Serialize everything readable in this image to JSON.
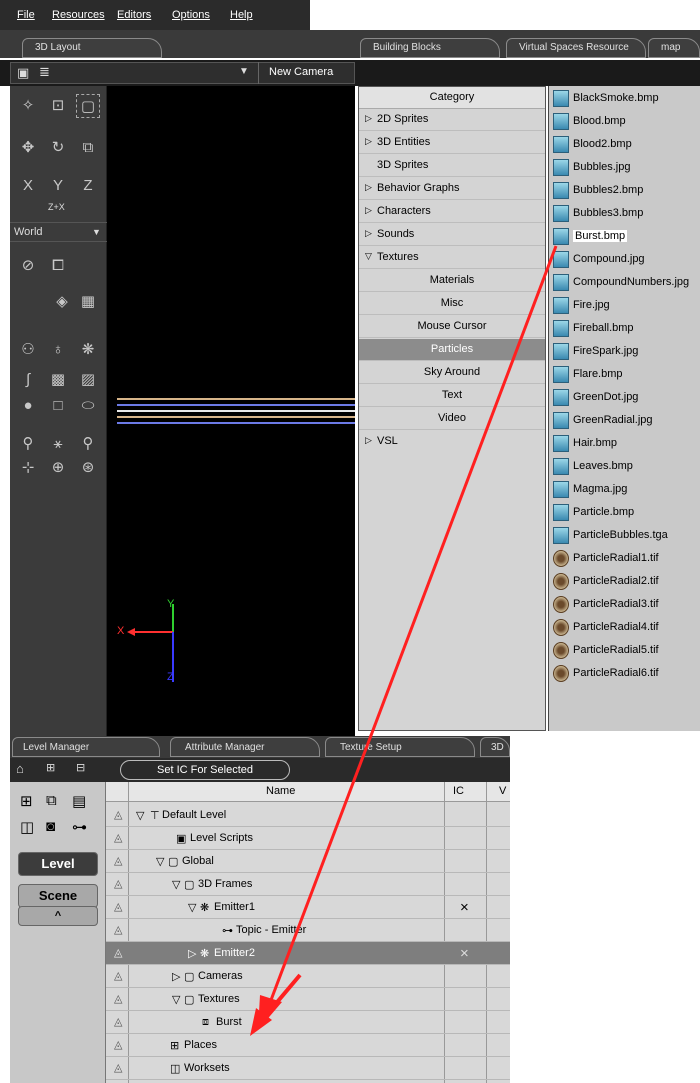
{
  "menu": [
    "File",
    "Resources",
    "Editors",
    "Options",
    "Help"
  ],
  "tabs": {
    "layout": "3D Layout",
    "building_blocks": "Building Blocks",
    "virtual_spaces": "Virtual Spaces Resource",
    "map": "map"
  },
  "toolbar": {
    "camera": "New Camera"
  },
  "palette": {
    "z_plus_x": "Z+X",
    "world": "World"
  },
  "viewport": {
    "axis_y": "Y",
    "axis_x": "X",
    "axis_z": "Z"
  },
  "categories": {
    "header": "Category",
    "items": [
      "2D Sprites",
      "3D Entities",
      "3D Sprites",
      "Behavior Graphs",
      "Characters",
      "Sounds",
      "Textures",
      "Materials",
      "Misc",
      "Mouse Cursor",
      "Particles",
      "Sky Around",
      "Text",
      "Video",
      "VSL"
    ]
  },
  "files": [
    "BlackSmoke.bmp",
    "Blood.bmp",
    "Blood2.bmp",
    "Bubbles.jpg",
    "Bubbles2.bmp",
    "Bubbles3.bmp",
    "Burst.bmp",
    "Compound.jpg",
    "CompoundNumbers.jpg",
    "Fire.jpg",
    "Fireball.bmp",
    "FireSpark.jpg",
    "Flare.bmp",
    "GreenDot.jpg",
    "GreenRadial.jpg",
    "Hair.bmp",
    "Leaves.bmp",
    "Magma.jpg",
    "Particle.bmp",
    "ParticleBubbles.tga",
    "ParticleRadial1.tif",
    "ParticleRadial2.tif",
    "ParticleRadial3.tif",
    "ParticleRadial4.tif",
    "ParticleRadial5.tif",
    "ParticleRadial6.tif"
  ],
  "bottom_tabs": {
    "level_manager": "Level Manager",
    "attribute_manager": "Attribute Manager",
    "texture_setup": "Texture Setup",
    "more": "3D"
  },
  "bottom_toolbar": {
    "set_ic": "Set IC For Selected"
  },
  "lm_left": {
    "level": "Level",
    "scene": "Scene",
    "up": "^"
  },
  "tree": {
    "col_name": "Name",
    "col_ic": "IC",
    "col_v": "V",
    "rows": [
      "Default Level",
      "Level Scripts",
      "Global",
      "3D Frames",
      "Emitter1",
      "Topic - Emitter",
      "Emitter2",
      "Cameras",
      "Textures",
      "Burst",
      "Places",
      "Worksets"
    ],
    "ic_mark": "×"
  },
  "colors": {
    "arrow": "#ff2020",
    "selected_row": "#7e7e7e",
    "dark_bg": "#2b2b2b"
  }
}
